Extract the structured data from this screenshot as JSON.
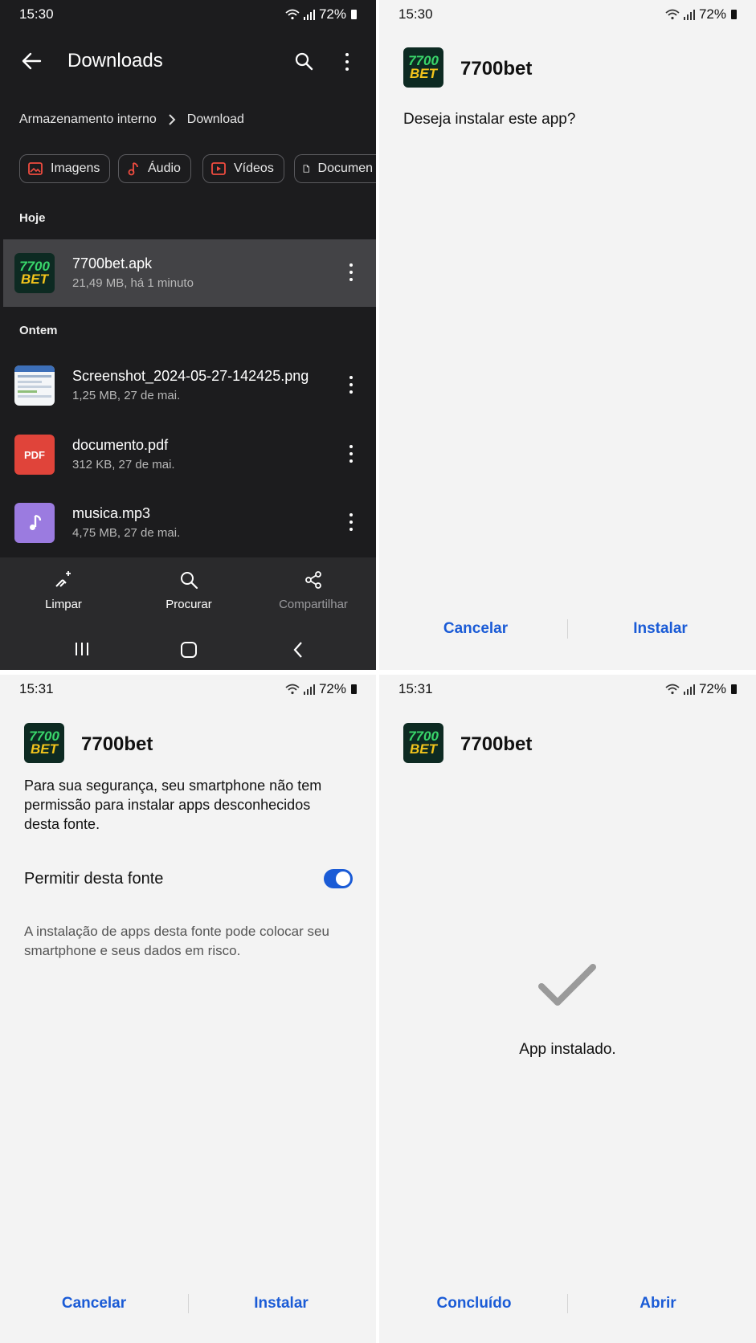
{
  "panel1": {
    "status": {
      "time": "15:30",
      "battery": "72%"
    },
    "toolbar": {
      "title": "Downloads"
    },
    "breadcrumb": {
      "root": "Armazenamento interno",
      "current": "Download"
    },
    "chips": [
      {
        "label": "Imagens",
        "icon": "image-icon"
      },
      {
        "label": "Áudio",
        "icon": "music-note-icon"
      },
      {
        "label": "Vídeos",
        "icon": "video-icon"
      },
      {
        "label": "Documen",
        "icon": "document-icon"
      }
    ],
    "sections": {
      "today": "Hoje",
      "yesterday": "Ontem"
    },
    "files": [
      {
        "name": "7700bet.apk",
        "meta": "21,49 MB, há 1 minuto",
        "thumb": "app-logo"
      },
      {
        "name": "Screenshot_2024-05-27-142425.png",
        "meta": "1,25 MB, 27 de mai.",
        "thumb": "screenshot-thumb"
      },
      {
        "name": "documento.pdf",
        "meta": "312 KB, 27 de mai.",
        "thumb": "pdf-icon",
        "thumb_label": "PDF"
      },
      {
        "name": "musica.mp3",
        "meta": "4,75 MB, 27 de mai.",
        "thumb": "music-icon"
      }
    ],
    "bottom": {
      "clear": "Limpar",
      "search": "Procurar",
      "share": "Compartilhar"
    },
    "colors": {
      "background": "#1c1c1e",
      "chip_icon": "#ef4b3f",
      "pdf": "#e0443a",
      "music": "#9b7be0"
    }
  },
  "logo": {
    "line1": "7700",
    "line2": "BET"
  },
  "panel2": {
    "status": {
      "time": "15:30",
      "battery": "72%"
    },
    "app_name": "7700bet",
    "question": "Deseja instalar este app?",
    "cancel": "Cancelar",
    "install": "Instalar"
  },
  "panel3": {
    "status": {
      "time": "15:31",
      "battery": "72%"
    },
    "app_name": "7700bet",
    "message": "Para sua segurança, seu smartphone não tem permissão para instalar apps desconhecidos desta fonte.",
    "toggle_label": "Permitir desta fonte",
    "toggle_on": true,
    "warning": "A instalação de apps desta fonte pode colocar seu smartphone e seus dados em risco.",
    "cancel": "Cancelar",
    "install": "Instalar"
  },
  "panel4": {
    "status": {
      "time": "15:31",
      "battery": "72%"
    },
    "app_name": "7700bet",
    "installed": "App instalado.",
    "done": "Concluído",
    "open": "Abrir"
  },
  "accent": "#1a5bd6"
}
